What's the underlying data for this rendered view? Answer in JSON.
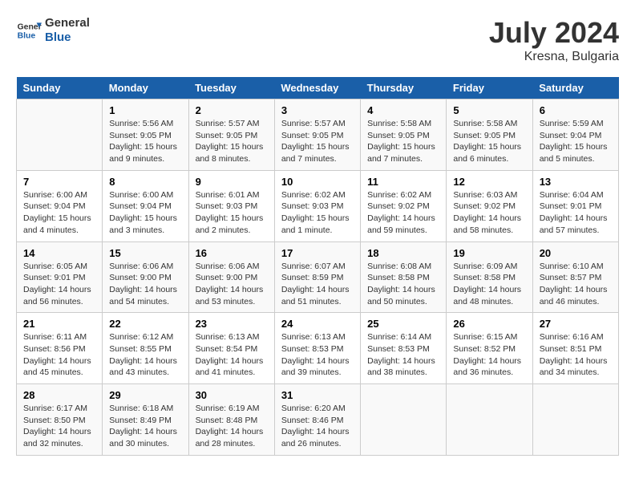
{
  "header": {
    "logo_line1": "General",
    "logo_line2": "Blue",
    "month": "July 2024",
    "location": "Kresna, Bulgaria"
  },
  "days_of_week": [
    "Sunday",
    "Monday",
    "Tuesday",
    "Wednesday",
    "Thursday",
    "Friday",
    "Saturday"
  ],
  "weeks": [
    [
      {
        "day": "",
        "info": ""
      },
      {
        "day": "1",
        "info": "Sunrise: 5:56 AM\nSunset: 9:05 PM\nDaylight: 15 hours\nand 9 minutes."
      },
      {
        "day": "2",
        "info": "Sunrise: 5:57 AM\nSunset: 9:05 PM\nDaylight: 15 hours\nand 8 minutes."
      },
      {
        "day": "3",
        "info": "Sunrise: 5:57 AM\nSunset: 9:05 PM\nDaylight: 15 hours\nand 7 minutes."
      },
      {
        "day": "4",
        "info": "Sunrise: 5:58 AM\nSunset: 9:05 PM\nDaylight: 15 hours\nand 7 minutes."
      },
      {
        "day": "5",
        "info": "Sunrise: 5:58 AM\nSunset: 9:05 PM\nDaylight: 15 hours\nand 6 minutes."
      },
      {
        "day": "6",
        "info": "Sunrise: 5:59 AM\nSunset: 9:04 PM\nDaylight: 15 hours\nand 5 minutes."
      }
    ],
    [
      {
        "day": "7",
        "info": "Sunrise: 6:00 AM\nSunset: 9:04 PM\nDaylight: 15 hours\nand 4 minutes."
      },
      {
        "day": "8",
        "info": "Sunrise: 6:00 AM\nSunset: 9:04 PM\nDaylight: 15 hours\nand 3 minutes."
      },
      {
        "day": "9",
        "info": "Sunrise: 6:01 AM\nSunset: 9:03 PM\nDaylight: 15 hours\nand 2 minutes."
      },
      {
        "day": "10",
        "info": "Sunrise: 6:02 AM\nSunset: 9:03 PM\nDaylight: 15 hours\nand 1 minute."
      },
      {
        "day": "11",
        "info": "Sunrise: 6:02 AM\nSunset: 9:02 PM\nDaylight: 14 hours\nand 59 minutes."
      },
      {
        "day": "12",
        "info": "Sunrise: 6:03 AM\nSunset: 9:02 PM\nDaylight: 14 hours\nand 58 minutes."
      },
      {
        "day": "13",
        "info": "Sunrise: 6:04 AM\nSunset: 9:01 PM\nDaylight: 14 hours\nand 57 minutes."
      }
    ],
    [
      {
        "day": "14",
        "info": "Sunrise: 6:05 AM\nSunset: 9:01 PM\nDaylight: 14 hours\nand 56 minutes."
      },
      {
        "day": "15",
        "info": "Sunrise: 6:06 AM\nSunset: 9:00 PM\nDaylight: 14 hours\nand 54 minutes."
      },
      {
        "day": "16",
        "info": "Sunrise: 6:06 AM\nSunset: 9:00 PM\nDaylight: 14 hours\nand 53 minutes."
      },
      {
        "day": "17",
        "info": "Sunrise: 6:07 AM\nSunset: 8:59 PM\nDaylight: 14 hours\nand 51 minutes."
      },
      {
        "day": "18",
        "info": "Sunrise: 6:08 AM\nSunset: 8:58 PM\nDaylight: 14 hours\nand 50 minutes."
      },
      {
        "day": "19",
        "info": "Sunrise: 6:09 AM\nSunset: 8:58 PM\nDaylight: 14 hours\nand 48 minutes."
      },
      {
        "day": "20",
        "info": "Sunrise: 6:10 AM\nSunset: 8:57 PM\nDaylight: 14 hours\nand 46 minutes."
      }
    ],
    [
      {
        "day": "21",
        "info": "Sunrise: 6:11 AM\nSunset: 8:56 PM\nDaylight: 14 hours\nand 45 minutes."
      },
      {
        "day": "22",
        "info": "Sunrise: 6:12 AM\nSunset: 8:55 PM\nDaylight: 14 hours\nand 43 minutes."
      },
      {
        "day": "23",
        "info": "Sunrise: 6:13 AM\nSunset: 8:54 PM\nDaylight: 14 hours\nand 41 minutes."
      },
      {
        "day": "24",
        "info": "Sunrise: 6:13 AM\nSunset: 8:53 PM\nDaylight: 14 hours\nand 39 minutes."
      },
      {
        "day": "25",
        "info": "Sunrise: 6:14 AM\nSunset: 8:53 PM\nDaylight: 14 hours\nand 38 minutes."
      },
      {
        "day": "26",
        "info": "Sunrise: 6:15 AM\nSunset: 8:52 PM\nDaylight: 14 hours\nand 36 minutes."
      },
      {
        "day": "27",
        "info": "Sunrise: 6:16 AM\nSunset: 8:51 PM\nDaylight: 14 hours\nand 34 minutes."
      }
    ],
    [
      {
        "day": "28",
        "info": "Sunrise: 6:17 AM\nSunset: 8:50 PM\nDaylight: 14 hours\nand 32 minutes."
      },
      {
        "day": "29",
        "info": "Sunrise: 6:18 AM\nSunset: 8:49 PM\nDaylight: 14 hours\nand 30 minutes."
      },
      {
        "day": "30",
        "info": "Sunrise: 6:19 AM\nSunset: 8:48 PM\nDaylight: 14 hours\nand 28 minutes."
      },
      {
        "day": "31",
        "info": "Sunrise: 6:20 AM\nSunset: 8:46 PM\nDaylight: 14 hours\nand 26 minutes."
      },
      {
        "day": "",
        "info": ""
      },
      {
        "day": "",
        "info": ""
      },
      {
        "day": "",
        "info": ""
      }
    ]
  ]
}
